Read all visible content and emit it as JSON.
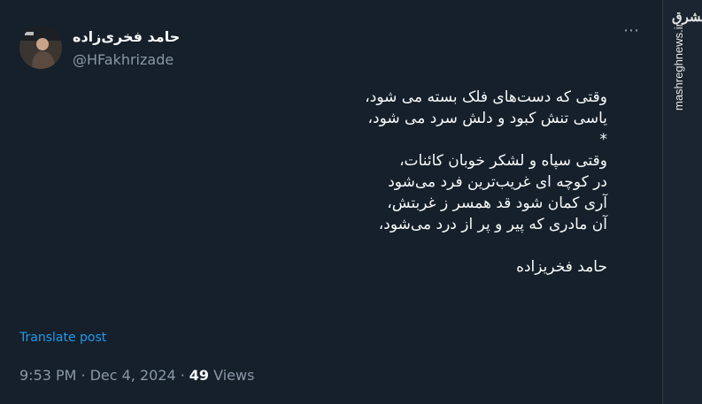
{
  "author": {
    "name": "حامد فخری‌زاده",
    "handle": "@HFakhrizade"
  },
  "more_menu": {
    "icon": "more-horizontal-icon",
    "label": "⋯"
  },
  "tweet": {
    "lines": [
      "وقتی که دست‌های فلک بسته می شود،",
      "یاسی تنش کبود و دلش سرد می شود،",
      "*",
      "وقتی سپاه و لشکر خوبان کائنات،",
      "در کوچه ای غریب‌ترین فرد می‌شود",
      "آری کمان شود قد همسر ز غربتش،",
      "آن مادری که پیر و پر از درد می‌شود،",
      "",
      "حامد فخریزاده"
    ]
  },
  "translate_label": "Translate post",
  "meta": {
    "time": "9:53 PM",
    "separator": "·",
    "date": "Dec 4, 2024",
    "views_count": "49",
    "views_label": "Views"
  },
  "watermark": {
    "logo_text": "مشرق",
    "url": "mashreghnews.ir"
  }
}
